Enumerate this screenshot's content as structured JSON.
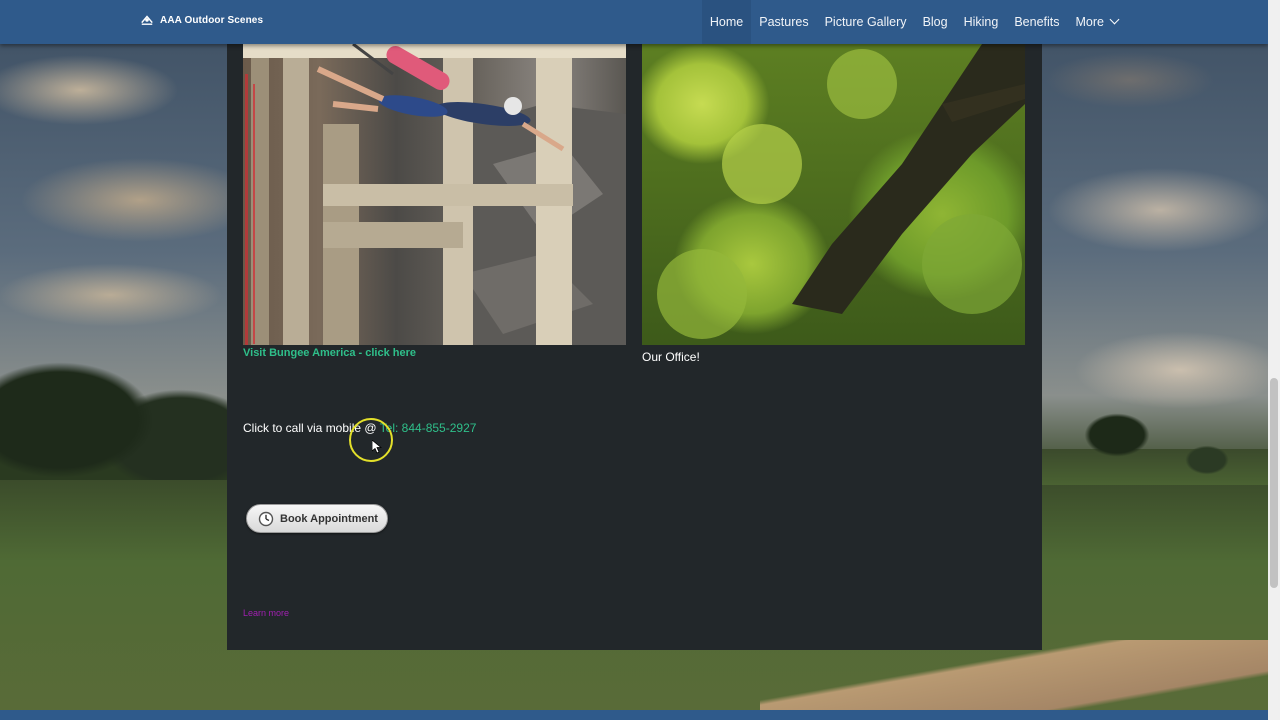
{
  "brand": {
    "name": "AAA Outdoor Scenes",
    "icon": "brand-logo-icon"
  },
  "nav": {
    "items": [
      {
        "label": "Home",
        "active": true
      },
      {
        "label": "Pastures",
        "active": false
      },
      {
        "label": "Picture Gallery",
        "active": false
      },
      {
        "label": "Blog",
        "active": false
      },
      {
        "label": "Hiking",
        "active": false
      },
      {
        "label": "Benefits",
        "active": false
      },
      {
        "label": "More",
        "active": false,
        "icon": "chevron-down-icon"
      }
    ]
  },
  "content": {
    "left_photo": {
      "icon": "bungee-jump-photo"
    },
    "left_caption_link": "Visit Bungee America - click here",
    "right_photo": {
      "icon": "office-forest-photo"
    },
    "right_caption": "Our Office!",
    "call": {
      "prefix": "Click to call via mobile @ ",
      "phone": "Tel: 844-855-2927"
    },
    "book_button": {
      "label": "Book Appointment",
      "icon": "clock-icon"
    },
    "small_link": "Learn more"
  },
  "colors": {
    "navbar": "#2f5a8b",
    "panel": "#22272a",
    "link": "#2fbf8a",
    "small_link": "#a020b0"
  }
}
